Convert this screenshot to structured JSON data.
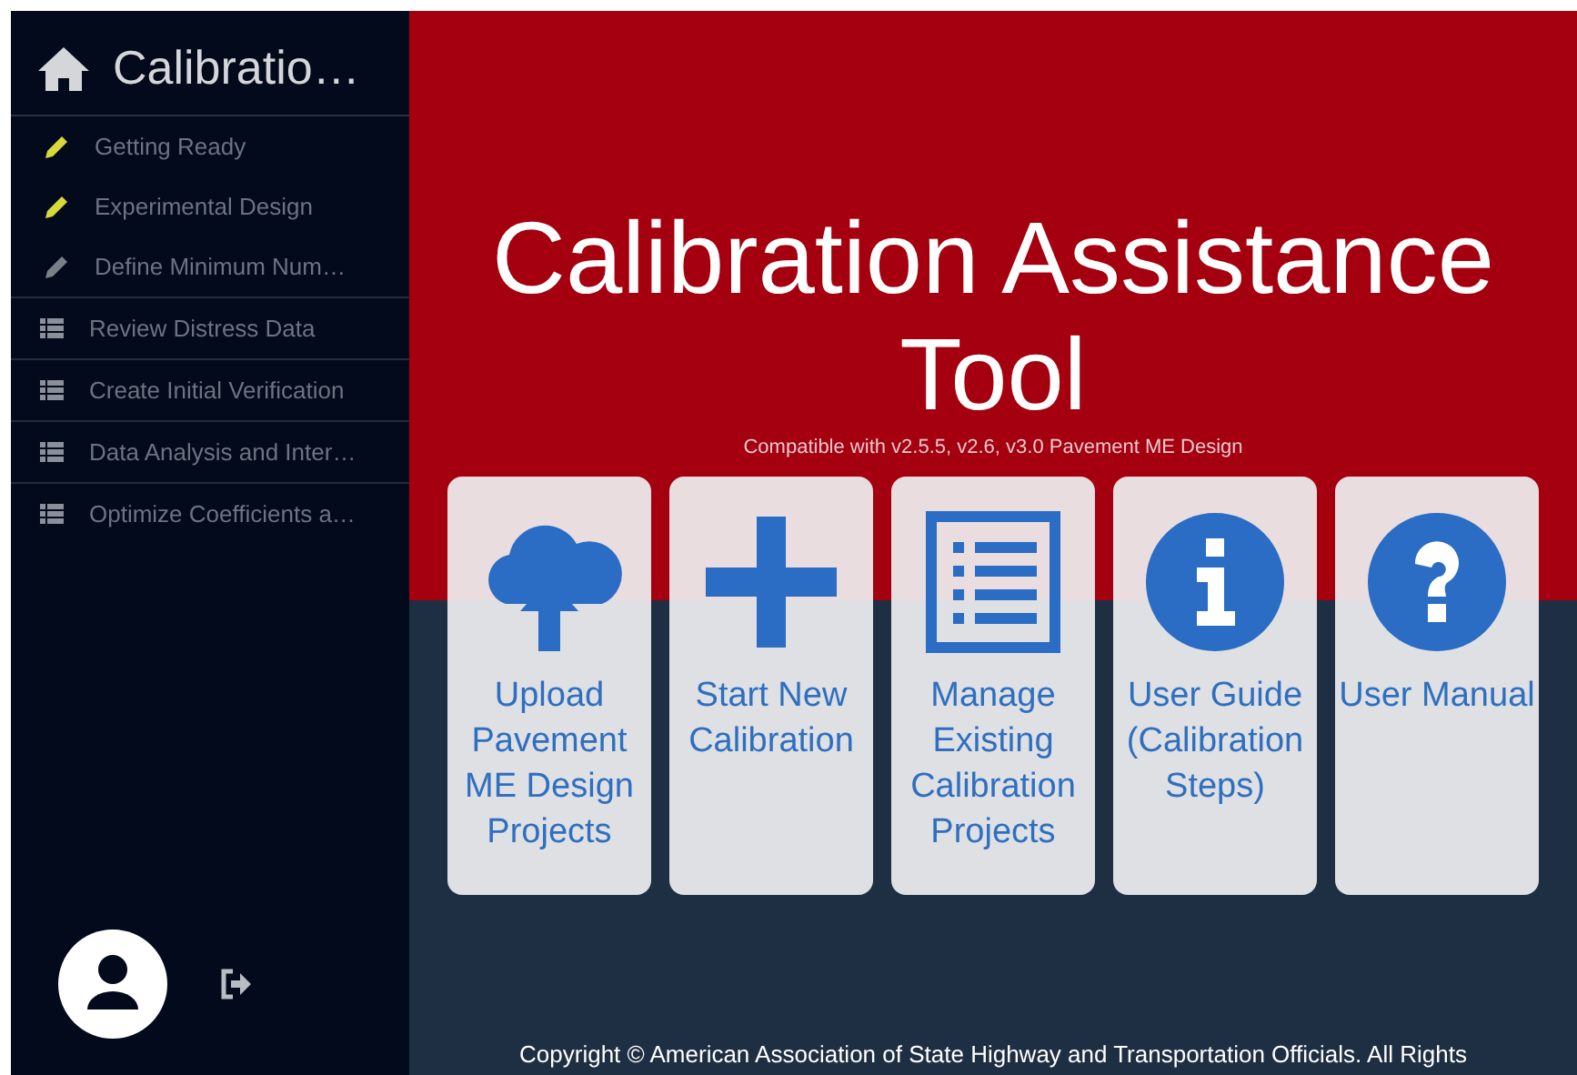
{
  "sidebar": {
    "title": "Calibratio…",
    "items": [
      {
        "kind": "step",
        "label": "Getting Ready",
        "done": true
      },
      {
        "kind": "step",
        "label": "Experimental Design",
        "done": true
      },
      {
        "kind": "step",
        "label": "Define Minimum Num…",
        "done": false
      },
      {
        "kind": "section",
        "label": "Review Distress Data"
      },
      {
        "kind": "section",
        "label": "Create Initial Verification"
      },
      {
        "kind": "section",
        "label": "Data Analysis and Inter…"
      },
      {
        "kind": "section",
        "label": "Optimize Coefficients a…"
      }
    ]
  },
  "hero": {
    "title": "Calibration Assistance Tool",
    "subtitle": "Compatible with v2.5.5, v2.6, v3.0 Pavement ME Design"
  },
  "cards": [
    {
      "kind": "upload",
      "label": "Upload Pavement ME Design Projects"
    },
    {
      "kind": "add",
      "label": "Start New Calibration"
    },
    {
      "kind": "list",
      "label": "Manage Existing Calibration Projects"
    },
    {
      "kind": "info",
      "label": "User Guide (Calibration Steps)"
    },
    {
      "kind": "help",
      "label": "User Manual"
    }
  ],
  "footer": "Copyright © American Association of State Highway and Transportation Officials. All Rights"
}
